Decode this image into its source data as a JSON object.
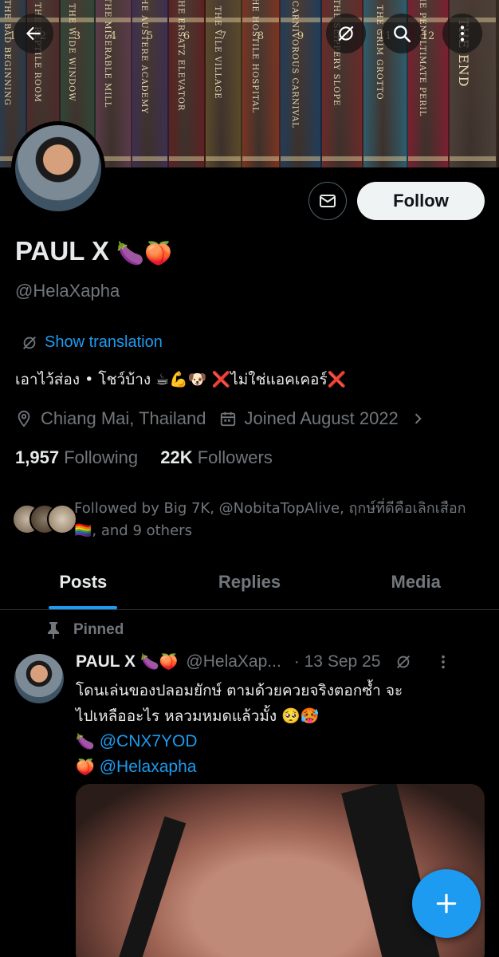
{
  "banner": {
    "books": [
      {
        "num": "1",
        "title": "THE BAD BEGINNING",
        "color": "#2b3a4a"
      },
      {
        "num": "2",
        "title": "THE REPTILE ROOM",
        "color": "#4c2a2a"
      },
      {
        "num": "3",
        "title": "THE WIDE WINDOW",
        "color": "#2f4636"
      },
      {
        "num": "4",
        "title": "THE MISERABLE MILL",
        "color": "#5a3a4a"
      },
      {
        "num": "5",
        "title": "THE AUSTERE ACADEMY",
        "color": "#3d2f50"
      },
      {
        "num": "6",
        "title": "THE ERSATZ ELEVATOR",
        "color": "#5c2222"
      },
      {
        "num": "7",
        "title": "THE VILE VILLAGE",
        "color": "#5a4a2a"
      },
      {
        "num": "8",
        "title": "THE HOSTILE HOSPITAL",
        "color": "#7a3422"
      },
      {
        "num": "9",
        "title": "THE CARNIVOROUS CARNIVAL",
        "color": "#213d5a"
      },
      {
        "num": "10",
        "title": "THE SLIPPERY SLOPE",
        "color": "#6a2a2a"
      },
      {
        "num": "11",
        "title": "THE GRIM GROTTO",
        "color": "#2e5c6c"
      },
      {
        "num": "12",
        "title": "THE PENULTIMATE PERIL",
        "color": "#7a2030"
      },
      {
        "num": "",
        "title": "THE END",
        "color": "#4a4038"
      }
    ]
  },
  "actions": {
    "follow_label": "Follow"
  },
  "profile": {
    "name": "PAUL X",
    "name_emoji": "🍆🍑",
    "handle": "@HelaXapha",
    "translate_label": "Show translation",
    "bio": "เอาไว้ส่อง • โชว์บ้าง ☕💪🐶 ❌ไม่ใช่แอคเคอร์❌",
    "location": "Chiang Mai, Thailand",
    "joined": "Joined August 2022",
    "following_count": "1,957",
    "following_label": "Following",
    "followers_count": "22K",
    "followers_label": "Followers",
    "followed_by": "Followed by Big 7K, @NobitaTopAlive, ฤกษ์ที่ดีคือเลิกเสือก 🏳️‍🌈, and 9 others"
  },
  "tabs": [
    {
      "label": "Posts",
      "active": true
    },
    {
      "label": "Replies",
      "active": false
    },
    {
      "label": "Media",
      "active": false
    }
  ],
  "post": {
    "pinned_label": "Pinned",
    "author_name": "PAUL X",
    "author_emoji": "🍆🍑",
    "author_handle": "@HelaXap...",
    "date": "· 13 Sep 25",
    "text_line1": "โดนเล่นของปลอมยักษ์ ตามด้วยควยจริงตอกซ้ำ จะ",
    "text_line2": "ไปเหลืออะไร หลวมหมดแล้วมั้ง 🥺🥵",
    "mention1_emoji": "🍆",
    "mention1": "@CNX7YOD",
    "mention2_emoji": "🍑",
    "mention2": "@Helaxapha"
  },
  "colors": {
    "accent": "#1d9bf0",
    "background": "#000000",
    "text_primary": "#e7e9ea",
    "text_secondary": "#71767b"
  },
  "icons": [
    "back-arrow-icon",
    "translate-icon",
    "search-icon",
    "more-vertical-icon",
    "mail-icon",
    "location-pin-icon",
    "calendar-icon",
    "chevron-right-icon",
    "pin-icon",
    "compose-plus-icon"
  ]
}
